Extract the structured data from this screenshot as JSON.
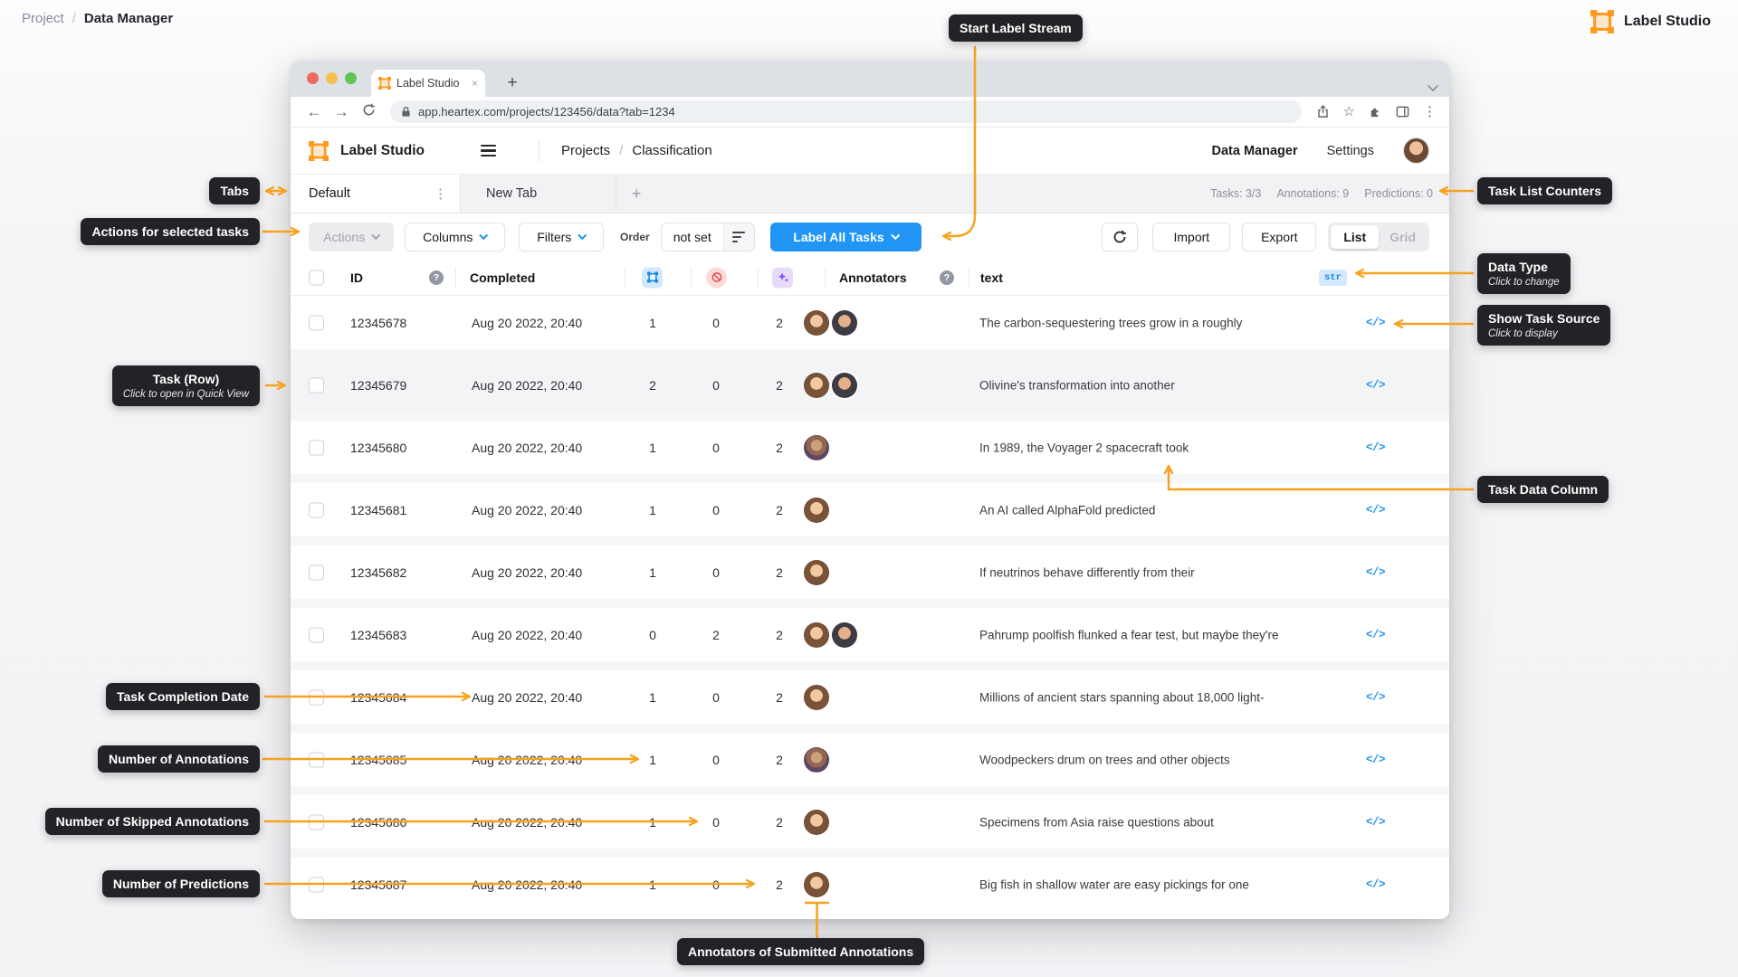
{
  "page": {
    "breadcrumb": {
      "parent": "Project",
      "separator": "/",
      "current": "Data Manager"
    },
    "brand": "Label Studio"
  },
  "browser": {
    "tab_title": "Label Studio",
    "close_tab": "×",
    "new_tab": "+",
    "url": "app.heartex.com/projects/123456/data?tab=1234",
    "back": "←",
    "forward": "→"
  },
  "header": {
    "brand": "Label Studio",
    "nav_parent": "Projects",
    "nav_separator": "/",
    "nav_current": "Classification",
    "menu_data_manager": "Data Manager",
    "menu_settings": "Settings"
  },
  "tabs": {
    "active": "Default",
    "inactive": "New Tab",
    "add": "+",
    "counters": [
      "Tasks: 3/3",
      "Annotations: 9",
      "Predictions: 0"
    ]
  },
  "toolbar": {
    "actions": "Actions",
    "columns": "Columns",
    "filters": "Filters",
    "order_label": "Order",
    "order_value": "not set",
    "label_all_tasks": "Label All Tasks",
    "import": "Import",
    "export": "Export",
    "view_list": "List",
    "view_grid": "Grid"
  },
  "table": {
    "columns": {
      "id": "ID",
      "completed": "Completed",
      "annotators": "Annotators",
      "text": "text"
    },
    "data_type_badge": "str",
    "source_icon_label": "</>",
    "rows": [
      {
        "id": "12345678",
        "completed": "Aug 20 2022, 20:40",
        "annotations": "1",
        "skipped": "0",
        "predictions": "2",
        "avatar_variants": [
          "av-v1",
          "av-v2"
        ],
        "text": "The carbon-sequestering trees grow in a roughly"
      },
      {
        "id": "12345679",
        "completed": "Aug 20 2022, 20:40",
        "annotations": "2",
        "skipped": "0",
        "predictions": "2",
        "avatar_variants": [
          "av-v1",
          "av-v2"
        ],
        "text": "Olivine's transformation into another"
      },
      {
        "id": "12345680",
        "completed": "Aug 20 2022, 20:40",
        "annotations": "1",
        "skipped": "0",
        "predictions": "2",
        "avatar_variants": [
          "av-v3"
        ],
        "text": "In 1989, the Voyager 2 spacecraft took"
      },
      {
        "id": "12345681",
        "completed": "Aug 20 2022, 20:40",
        "annotations": "1",
        "skipped": "0",
        "predictions": "2",
        "avatar_variants": [
          "av-v1"
        ],
        "text": "An AI called AlphaFold predicted"
      },
      {
        "id": "12345682",
        "completed": "Aug 20 2022, 20:40",
        "annotations": "1",
        "skipped": "0",
        "predictions": "2",
        "avatar_variants": [
          "av-v1"
        ],
        "text": "If neutrinos behave differently from their"
      },
      {
        "id": "12345683",
        "completed": "Aug 20 2022, 20:40",
        "annotations": "0",
        "skipped": "2",
        "predictions": "2",
        "avatar_variants": [
          "av-v1",
          "av-v2"
        ],
        "text": "Pahrump poolfish flunked a fear test, but maybe they're"
      },
      {
        "id": "12345684",
        "completed": "Aug 20 2022, 20:40",
        "annotations": "1",
        "skipped": "0",
        "predictions": "2",
        "avatar_variants": [
          "av-v1"
        ],
        "text": "Millions of ancient stars spanning about 18,000 light-"
      },
      {
        "id": "12345685",
        "completed": "Aug 20 2022, 20:40",
        "annotations": "1",
        "skipped": "0",
        "predictions": "2",
        "avatar_variants": [
          "av-v3"
        ],
        "text": "Woodpeckers drum on trees and other objects"
      },
      {
        "id": "12345686",
        "completed": "Aug 20 2022, 20:40",
        "annotations": "1",
        "skipped": "0",
        "predictions": "2",
        "avatar_variants": [
          "av-v1"
        ],
        "text": "Specimens from Asia raise questions about"
      },
      {
        "id": "12345687",
        "completed": "Aug 20 2022, 20:40",
        "annotations": "1",
        "skipped": "0",
        "predictions": "2",
        "avatar_variants": [
          "av-v1"
        ],
        "text": "Big fish in shallow water are easy pickings for one"
      }
    ]
  },
  "callouts": {
    "tabs": {
      "label": "Tabs"
    },
    "actions": {
      "label": "Actions for selected tasks"
    },
    "start_label_stream": {
      "label": "Start Label Stream"
    },
    "task_list_counters": {
      "label": "Task List Counters"
    },
    "data_type": {
      "label": "Data Type",
      "sublabel": "Click to change"
    },
    "show_task_source": {
      "label": "Show Task Source",
      "sublabel": "Click to display"
    },
    "task_row": {
      "label": "Task (Row)",
      "sublabel": "Click to open in Quick View"
    },
    "task_data_column": {
      "label": "Task Data Column"
    },
    "task_completion_date": {
      "label": "Task Completion Date"
    },
    "number_of_annotations": {
      "label": "Number of Annotations"
    },
    "number_of_skipped": {
      "label": "Number of Skipped Annotations"
    },
    "number_of_predictions": {
      "label": "Number of Predictions"
    },
    "annotators_submitted": {
      "label": "Annotators of Submitted Annotations"
    }
  },
  "colors": {
    "accent_orange": "#F6A21E",
    "primary_blue": "#2095F3",
    "brand_orange": "#FF9A1F"
  }
}
